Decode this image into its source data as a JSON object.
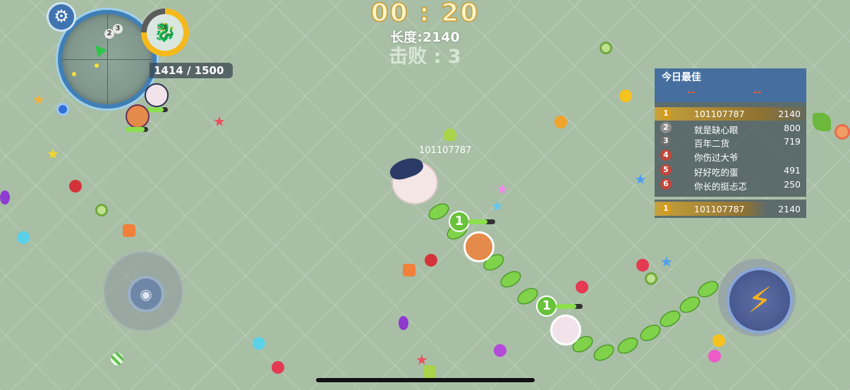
{
  "hud": {
    "timer": "00 : 20",
    "length": "长度:2140",
    "kills": "击败 : 3",
    "progress": "1414 / 1500"
  },
  "minimap": {
    "markers": [
      "2",
      "3"
    ]
  },
  "player": {
    "nickname": "101107787",
    "segment_levels": [
      "1",
      "1"
    ]
  },
  "leaderboard": {
    "title": "今日最佳",
    "dash_left": "--",
    "dash_right": "--",
    "rows": [
      {
        "rank": "1",
        "name": "101107787",
        "score": "2140",
        "color": "#d49a1c"
      },
      {
        "rank": "2",
        "name": "就是缺心眼",
        "score": "800",
        "color": "#8f8f8f"
      },
      {
        "rank": "3",
        "name": "百年二货",
        "score": "719",
        "color": "#6e6e6e"
      },
      {
        "rank": "4",
        "name": "你伤过大爷",
        "score": "",
        "color": "#c0463a"
      },
      {
        "rank": "5",
        "name": "好好吃的蛋",
        "score": "491",
        "color": "#c0463a"
      },
      {
        "rank": "6",
        "name": "你长的挺忐忑",
        "score": "250",
        "color": "#c0463a"
      }
    ],
    "me": {
      "rank": "1",
      "name": "101107787",
      "score": "2140"
    }
  },
  "colors": {
    "background": "#a8bfa6",
    "accent_blue": "#3f7fb6",
    "gold": "#d49a1c",
    "snake_green": "#7fd24a"
  },
  "icons": {
    "settings": "gear-icon",
    "joystick": "joystick-icon",
    "boost": "lightning-icon"
  }
}
